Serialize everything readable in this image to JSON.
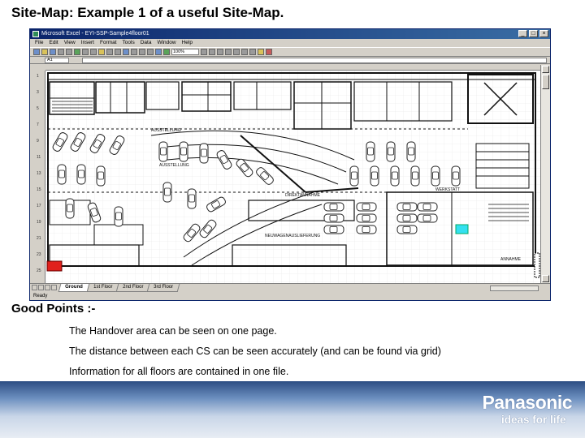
{
  "slide": {
    "title": "Site-Map: Example 1 of a useful Site-Map.",
    "good_points_heading": "Good Points :-",
    "bullets": [
      "The Handover area can be seen on one page.",
      "The distance between each CS can be seen accurately (and can be found via grid)",
      "Information for all floors are contained in one file."
    ]
  },
  "excel": {
    "window_title": "Microsoft Excel - EYI-SSP-Sample4floor01",
    "menu": [
      "File",
      "Edit",
      "View",
      "Insert",
      "Format",
      "Tools",
      "Data",
      "Window",
      "Help"
    ],
    "cell_ref": "A1",
    "zoom": "100%",
    "sheet_tabs": [
      "Ground",
      "1st Floor",
      "2nd Floor",
      "3rd Floor"
    ],
    "status": "Ready",
    "plan_labels": {
      "showroom": "AUSSTELLUNG",
      "workshop": "WERKSTATT",
      "acceptance": "ANNAHME",
      "reception": "DIREKTANNAHME",
      "new_cars": "NEUWAGENAUSLIEFERUNG"
    }
  },
  "brand": {
    "name": "Panasonic",
    "tagline": "ideas for life"
  },
  "colors": {
    "excel_titlebar": "#0a246a",
    "marker_red": "#e0201c",
    "marker_cyan": "#33e0f0",
    "footer_dark": "#2c4d83"
  }
}
